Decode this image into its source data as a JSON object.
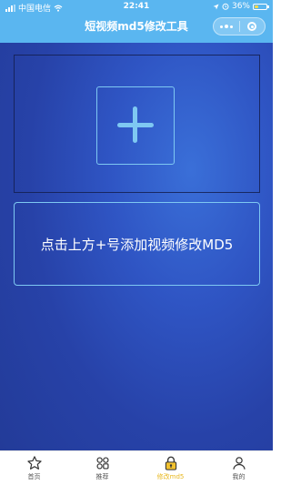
{
  "status_bar": {
    "carrier": "中国电信",
    "time": "22:41",
    "battery": "36%",
    "battery_level": 0.36
  },
  "nav": {
    "title": "短视频md5修改工具"
  },
  "main": {
    "add_symbol": "+",
    "hint": "点击上方+号添加视频修改MD5"
  },
  "tabs": [
    {
      "label": "首页",
      "icon": "star-icon",
      "active": false
    },
    {
      "label": "推荐",
      "icon": "grid-icon",
      "active": false
    },
    {
      "label": "修改md5",
      "icon": "lock-icon",
      "active": true
    },
    {
      "label": "我的",
      "icon": "person-icon",
      "active": false
    }
  ],
  "colors": {
    "nav_bg": "#5ab6f0",
    "accent_border": "#7ec8f2",
    "active_tab": "#e8b820",
    "background": "#2f55c4"
  }
}
